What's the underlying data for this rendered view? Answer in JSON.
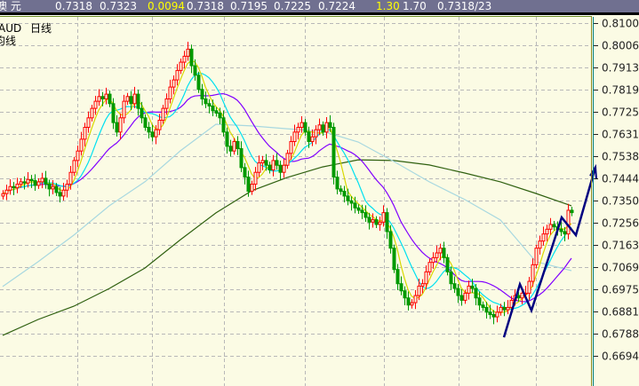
{
  "header": {
    "name": "澳 元",
    "values": [
      "0.7318",
      "0.7323",
      "0.0094",
      "0.7318",
      "0.7195",
      "0.7225",
      "0.7224",
      "1.30",
      "1.70",
      "0.7318/23"
    ]
  },
  "labels": {
    "symbol": "AUD",
    "period": "日线",
    "ma_label": "均线"
  },
  "colors": {
    "header_bg": "#707090",
    "plot_bg": "#fbfbe4",
    "up": "#ff0000",
    "down": "#009900",
    "ma5": "#d8d800",
    "ma10": "#00e0f0",
    "ma20": "#8000ff",
    "ma60": "#a8d8e0",
    "ma120": "#2f6010",
    "zigzag": "#000080",
    "grid": "#b8b8b8"
  },
  "chart_data": {
    "type": "candlestick",
    "title": "",
    "y_ticks": [
      "0.8100",
      "0.8006",
      "0.7913",
      "0.7819",
      "0.7725",
      "0.7631",
      "0.7538",
      "0.7444",
      "0.7350",
      "0.7256",
      "0.7163",
      "0.7069",
      "0.6975",
      "0.6881",
      "0.6788",
      "0.6694"
    ],
    "ylim": [
      0.662,
      0.814
    ],
    "grid": true,
    "closes": [
      0.738,
      0.7395,
      0.741,
      0.7405,
      0.742,
      0.743,
      0.7425,
      0.744,
      0.7435,
      0.7415,
      0.743,
      0.7445,
      0.742,
      0.74,
      0.741,
      0.7385,
      0.737,
      0.7395,
      0.742,
      0.747,
      0.752,
      0.756,
      0.761,
      0.766,
      0.77,
      0.774,
      0.777,
      0.779,
      0.778,
      0.78,
      0.776,
      0.768,
      0.764,
      0.77,
      0.777,
      0.779,
      0.776,
      0.78,
      0.774,
      0.77,
      0.766,
      0.764,
      0.762,
      0.765,
      0.769,
      0.774,
      0.778,
      0.783,
      0.786,
      0.79,
      0.7935,
      0.796,
      0.799,
      0.792,
      0.788,
      0.782,
      0.778,
      0.776,
      0.775,
      0.773,
      0.772,
      0.77,
      0.764,
      0.758,
      0.756,
      0.76,
      0.757,
      0.749,
      0.745,
      0.739,
      0.742,
      0.747,
      0.751,
      0.752,
      0.75,
      0.748,
      0.752,
      0.75,
      0.747,
      0.75,
      0.755,
      0.76,
      0.764,
      0.766,
      0.768,
      0.764,
      0.76,
      0.762,
      0.765,
      0.767,
      0.764,
      0.768,
      0.766,
      0.745,
      0.74,
      0.739,
      0.737,
      0.735,
      0.734,
      0.732,
      0.731,
      0.73,
      0.728,
      0.726,
      0.727,
      0.725,
      0.726,
      0.73,
      0.722,
      0.715,
      0.706,
      0.7,
      0.697,
      0.694,
      0.691,
      0.692,
      0.695,
      0.699,
      0.7,
      0.705,
      0.709,
      0.711,
      0.713,
      0.715,
      0.711,
      0.705,
      0.7,
      0.698,
      0.695,
      0.693,
      0.696,
      0.699,
      0.698,
      0.694,
      0.691,
      0.69,
      0.688,
      0.687,
      0.686,
      0.688,
      0.69,
      0.689,
      0.69,
      0.693,
      0.695,
      0.694,
      0.696,
      0.696,
      0.701,
      0.708,
      0.715,
      0.718,
      0.721,
      0.723,
      0.725,
      0.724,
      0.723,
      0.722,
      0.721,
      0.731,
      0.73
    ],
    "moving_averages": {
      "computed": [
        5,
        10,
        20
      ]
    },
    "ma60_every10": [
      0.6988,
      0.7093,
      0.7205,
      0.7329,
      0.743,
      0.7561,
      0.7673,
      0.7666,
      0.7654,
      0.7643,
      0.7598,
      0.7516,
      0.743,
      0.7355,
      0.7269,
      0.7093,
      0.7055
    ],
    "ma120_every10": [
      0.6782,
      0.6849,
      0.6905,
      0.698,
      0.7066,
      0.7186,
      0.7299,
      0.7392,
      0.7448,
      0.7493,
      0.7523,
      0.752,
      0.7501,
      0.7467,
      0.743,
      0.7381,
      0.7329
    ],
    "zigzag": [
      [
        141,
        0.6774
      ],
      [
        145.5,
        0.6998
      ],
      [
        148.75,
        0.6887
      ],
      [
        157.25,
        0.728
      ],
      [
        161.25,
        0.7205
      ],
      [
        166.75,
        0.7493
      ]
    ]
  }
}
